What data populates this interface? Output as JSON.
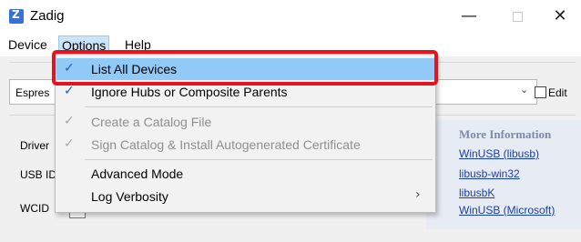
{
  "window": {
    "title": "Zadig",
    "minimize_glyph": "—",
    "close_glyph": "✕"
  },
  "menubar": {
    "device": "Device",
    "options": "Options",
    "help": "Help"
  },
  "client": {
    "device_combo_value": "Espres",
    "edit_label": "Edit",
    "labels": {
      "driver": "Driver",
      "usb_id": "USB ID",
      "wcid": "WCID"
    },
    "info": {
      "title": "More Information",
      "links": [
        "WinUSB (libusb)",
        "libusb-win32",
        "libusbK",
        "WinUSB (Microsoft)"
      ]
    }
  },
  "options_menu": {
    "items": [
      {
        "label": "List All Devices",
        "checked": true,
        "enabled": true,
        "highlighted": true
      },
      {
        "label": "Ignore Hubs or Composite Parents",
        "checked": true,
        "enabled": true
      },
      {
        "label": "Create a Catalog File",
        "checked": true,
        "enabled": false
      },
      {
        "label": "Sign Catalog & Install Autogenerated Certificate",
        "checked": true,
        "enabled": false
      },
      {
        "label": "Advanced Mode",
        "checked": false,
        "enabled": true
      },
      {
        "label": "Log Verbosity",
        "checked": false,
        "enabled": true,
        "submenu": true
      }
    ],
    "check_glyph": "✓",
    "submenu_glyph": "›"
  },
  "colors": {
    "highlight_border": "#e5131d",
    "menu_hover": "#91c9f7",
    "link": "#1a3fa6"
  },
  "icons": [
    "app-icon",
    "minimize-icon",
    "maximize-icon",
    "close-icon",
    "check-icon",
    "chevron-down-icon",
    "submenu-arrow-icon"
  ]
}
